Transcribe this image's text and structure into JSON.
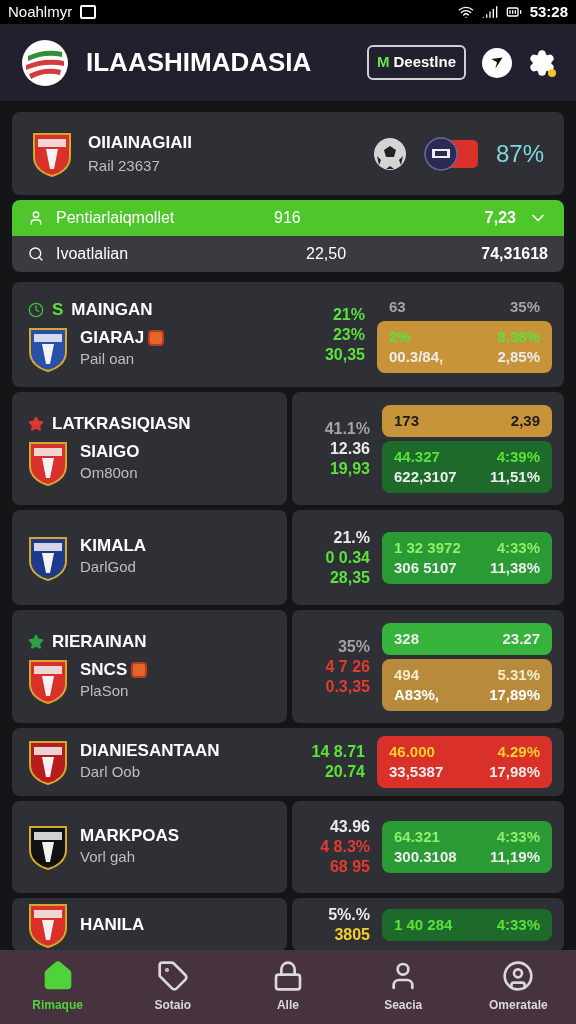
{
  "status_bar": {
    "carrier": "Noahlmyr",
    "time": "53:28"
  },
  "header": {
    "title": "ILAASHIMADASIA",
    "button": {
      "mark": "M",
      "label": "Deestlne"
    }
  },
  "featured": {
    "name": "OIIAINAGIAII",
    "subtitle": "Rail 23637",
    "percent": "87%"
  },
  "summary": [
    {
      "kind": "highlight",
      "label": "Pentiarlaiqmollet",
      "value": "916",
      "total": "7,23",
      "expanded": false
    },
    {
      "kind": "search",
      "label": "Ivoatlalian",
      "value": "22,50",
      "total": "74,31618"
    }
  ],
  "matches": [
    {
      "kind": "full",
      "league": {
        "prefix": "S",
        "text": "MAINGAN",
        "color": "#3fbf3a"
      },
      "team": "GIARAJ",
      "badge": true,
      "sub": "Pail oan",
      "odds": [
        {
          "text": "21%",
          "color": "#5be23b"
        },
        {
          "text": "23%",
          "color": "#5be23b"
        },
        {
          "text": "30,35",
          "color": "#5be23b"
        }
      ],
      "boxes": [
        {
          "lines": [
            {
              "a": "63",
              "b": "35%",
              "color": "#a3a3a8"
            }
          ]
        },
        {
          "color": "#c8943a",
          "lines": [
            {
              "a": "2%",
              "b": "8.38%",
              "color": "#5be23b"
            },
            {
              "a": "00.3/84,",
              "b": "2,85%",
              "color": "#ececec"
            }
          ]
        }
      ]
    },
    {
      "kind": "split",
      "league": {
        "text": "LATKRASIQIASN",
        "color": "#d93a2f"
      },
      "team": "SIAIGO",
      "badge": false,
      "sub": "Om80on",
      "odds": [
        {
          "text": "41.1%",
          "color": "#a3a3a8"
        },
        {
          "text": "12.36",
          "color": "#ececec"
        },
        {
          "text": "19,93",
          "color": "#5be23b"
        }
      ],
      "boxes": [
        {
          "color": "#c8943a",
          "lines": [
            {
              "a": "173",
              "b": "2,39",
              "color": "#1d1d1d"
            }
          ]
        },
        {
          "color": "#1d6a2a",
          "lines": [
            {
              "a": "44.327",
              "b": "4:39%",
              "color": "#5be23b"
            },
            {
              "a": "622,3107",
              "b": "11,51%",
              "color": "#ececec"
            }
          ]
        }
      ]
    },
    {
      "kind": "split",
      "team": "KIMALA",
      "badge": false,
      "sub": "DarlGod",
      "odds": [
        {
          "text": "21.%",
          "color": "#ececec"
        },
        {
          "text": "0 0.34",
          "color": "#5be23b"
        },
        {
          "text": "28,35",
          "color": "#5be23b"
        }
      ],
      "boxes": [
        {
          "color": "#2a9a35",
          "lines": [
            {
              "a": "1 32 3972",
              "b": "4:33%",
              "color": "#8ef06a"
            },
            {
              "a": "306 5107",
              "b": "11,38%",
              "color": "#ececec"
            }
          ]
        }
      ]
    },
    {
      "kind": "split",
      "league": {
        "text": "RIERAINAN",
        "color": "#2ea043"
      },
      "team": "SNCS",
      "badge": true,
      "sub": "PlaSon",
      "odds": [
        {
          "text": "35%",
          "color": "#a3a3a8"
        },
        {
          "text": "4 7 26",
          "color": "#e23b2f"
        },
        {
          "text": "0.3,35",
          "color": "#e23b2f"
        }
      ],
      "boxes": [
        {
          "color": "#36b33a",
          "lines": [
            {
              "a": "328",
              "b": "23.27",
              "color": "#ececec"
            }
          ]
        },
        {
          "color": "#b88a3c",
          "lines": [
            {
              "a": "494",
              "b": "5.31%",
              "color": "#f5ecc8"
            },
            {
              "a": "A83%,",
              "b": "17,89%",
              "color": "#ffffff"
            }
          ]
        }
      ]
    },
    {
      "kind": "full",
      "team": "DIANIESANTAAN",
      "badge": false,
      "sub": "Darl Oob",
      "odds": [
        {
          "text": "14 8.71",
          "color": "#5be23b"
        },
        {
          "text": "20.74",
          "color": "#5be23b"
        }
      ],
      "boxes": [
        {
          "color": "#d9302a",
          "lines": [
            {
              "a": "46.000",
              "b": "4.29%",
              "color": "#f3d02a"
            },
            {
              "a": "33,5387",
              "b": "17,98%",
              "color": "#ececec"
            }
          ]
        }
      ]
    },
    {
      "kind": "split",
      "team": "MARKPOAS",
      "badge": false,
      "sub": "Vorl gah",
      "odds": [
        {
          "text": "43.96",
          "color": "#ececec"
        },
        {
          "text": "4 8.3%",
          "color": "#e23b2f"
        },
        {
          "text": "68 95",
          "color": "#e23b2f"
        }
      ],
      "boxes": [
        {
          "color": "#2a9a35",
          "lines": [
            {
              "a": "64.321",
              "b": "4:33%",
              "color": "#8ef06a"
            },
            {
              "a": "300.3108",
              "b": "11,19%",
              "color": "#ececec"
            }
          ]
        }
      ]
    },
    {
      "kind": "split",
      "team": "HANILA",
      "badge": false,
      "odds": [
        {
          "text": "5%.%",
          "color": "#ececec"
        },
        {
          "text": "3805",
          "color": "#f3d02a"
        }
      ],
      "boxes": [
        {
          "color": "#1d6a2a",
          "lines": [
            {
              "a": "1 40 284",
              "b": "4:33%",
              "color": "#5be23b"
            }
          ]
        }
      ]
    }
  ],
  "nav": [
    {
      "label": "Rimaque",
      "selected": true
    },
    {
      "label": "Sotaio",
      "selected": false
    },
    {
      "label": "Alle",
      "selected": false
    },
    {
      "label": "Seacia",
      "selected": false
    },
    {
      "label": "Omeratale",
      "selected": false
    }
  ]
}
